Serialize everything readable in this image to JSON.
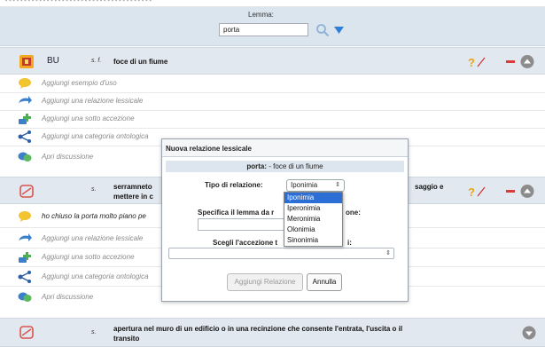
{
  "topbar": {
    "text": "- - - - - - - - - - - - - - - - - - - - - - - - - - - - - - - - - - - - - - -"
  },
  "lemma": {
    "label": "Lemma:",
    "value": "porta"
  },
  "entry1": {
    "code": "BU",
    "pos": "s. f.",
    "definition": "foce di un fiume",
    "actions": [
      {
        "label": "Aggiungi esempio d'uso",
        "icon": "speech-bubble-icon"
      },
      {
        "label": "Aggiungi una relazione lessicale",
        "icon": "relation-icon"
      },
      {
        "label": "Aggiungi una sotto accezione",
        "icon": "add-subsense-icon"
      },
      {
        "label": "Aggiungi una categoria ontologica",
        "icon": "ontology-icon"
      },
      {
        "label": "Apri discussione",
        "icon": "discussion-icon"
      }
    ]
  },
  "entry2": {
    "pos": "s.",
    "definition_line1": "serramneto",
    "definition_line2": "mettere in c",
    "definition_right": "saggio e",
    "example": "ho chiuso la porta molto piano pe",
    "actions": [
      {
        "label": "Aggiungi una relazione lessicale",
        "icon": "relation-icon"
      },
      {
        "label": "Aggiungi una sotto accezione",
        "icon": "add-subsense-icon"
      },
      {
        "label": "Aggiungi una categoria ontologica",
        "icon": "ontology-icon"
      },
      {
        "label": "Apri discussione",
        "icon": "discussion-icon"
      }
    ]
  },
  "entry3": {
    "pos": "s.",
    "definition_line1": "apertura nel muro di un edificio o in una recinzione che consente l'entrata, l'uscita o il",
    "definition_line2": "transito"
  },
  "modal": {
    "title": "Nuova relazione lessicale",
    "subtitle_word": "porta:",
    "subtitle_def": " - foce di un fiume",
    "type_label": "Tipo di relazione:",
    "type_value": "Iponimia",
    "lemma_label": "Specifica il lemma da r",
    "lemma_label_tail": "one:",
    "sense_label": "Scegli l'accezione t",
    "sense_label_tail": "i:",
    "add_button": "Aggiungi Relazione",
    "cancel_button": "Annulla",
    "options": [
      "Iponimia",
      "Iperonimia",
      "Meronimia",
      "Olonimia",
      "Sinonimia"
    ],
    "selected_option": "Iponimia"
  },
  "colors": {
    "accent": "#2b6fd6",
    "header_bg": "#dbe5ee",
    "entry_bg": "#e2e8ef"
  }
}
